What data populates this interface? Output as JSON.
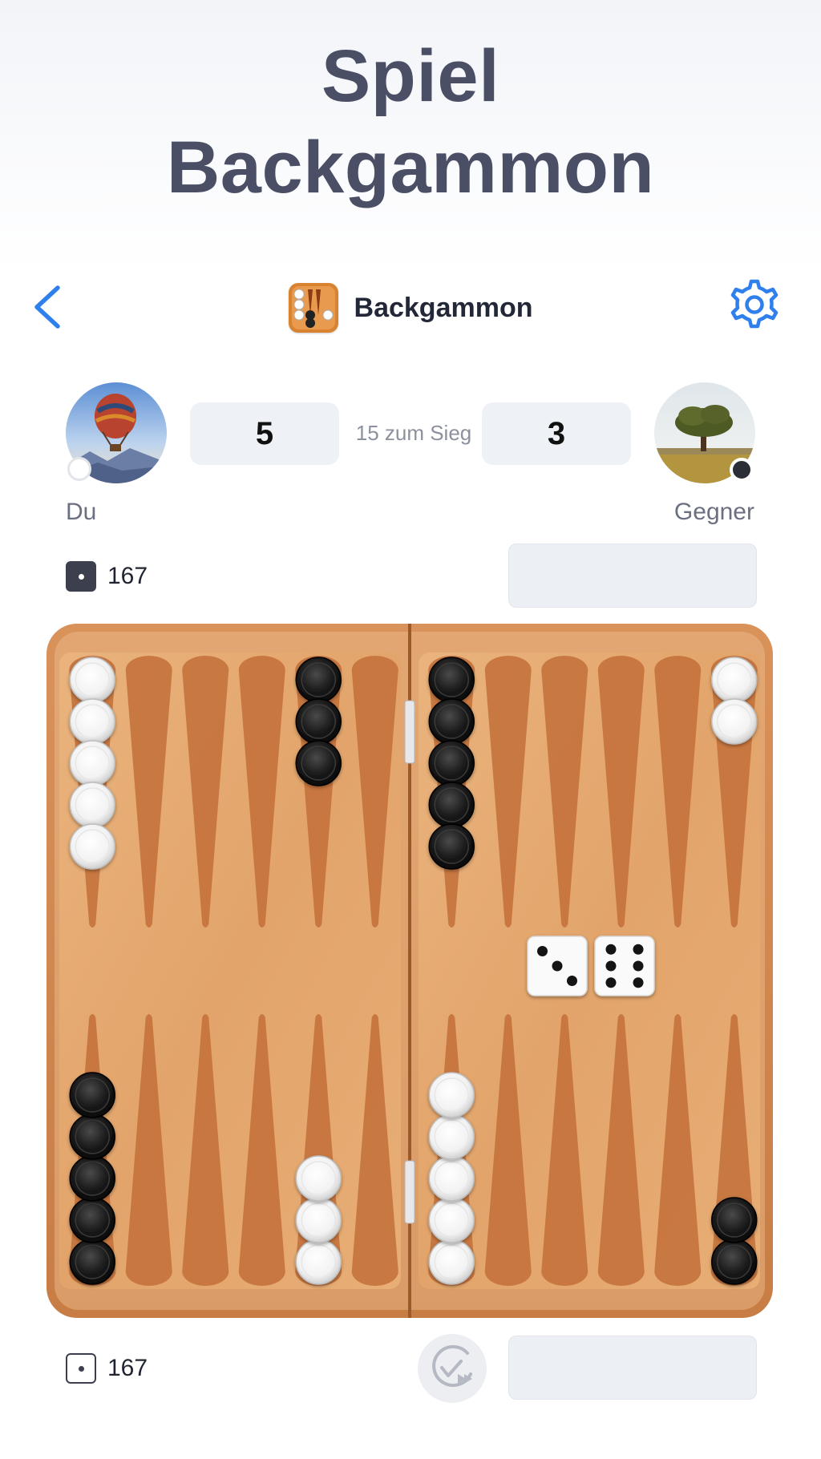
{
  "hero": {
    "line1": "Spiel",
    "line2": "Backgammon"
  },
  "topbar": {
    "title": "Backgammon",
    "back_icon": "chevron-left-icon",
    "settings_icon": "gear-icon",
    "accent_color": "#2f80ed"
  },
  "match": {
    "player": {
      "name": "Du",
      "score": "5",
      "checker_color": "white",
      "pip_count": "167"
    },
    "opponent": {
      "name": "Gegner",
      "score": "3",
      "checker_color": "black",
      "pip_count": "167"
    },
    "target_label": "15 zum Sieg"
  },
  "board": {
    "top_points": [
      {
        "color": "white",
        "count": 5
      },
      {
        "color": "none",
        "count": 0
      },
      {
        "color": "none",
        "count": 0
      },
      {
        "color": "none",
        "count": 0
      },
      {
        "color": "black",
        "count": 3
      },
      {
        "color": "none",
        "count": 0
      },
      {
        "color": "black",
        "count": 5
      },
      {
        "color": "none",
        "count": 0
      },
      {
        "color": "none",
        "count": 0
      },
      {
        "color": "none",
        "count": 0
      },
      {
        "color": "none",
        "count": 0
      },
      {
        "color": "white",
        "count": 2
      }
    ],
    "bottom_points": [
      {
        "color": "black",
        "count": 5
      },
      {
        "color": "none",
        "count": 0
      },
      {
        "color": "none",
        "count": 0
      },
      {
        "color": "none",
        "count": 0
      },
      {
        "color": "white",
        "count": 3
      },
      {
        "color": "none",
        "count": 0
      },
      {
        "color": "white",
        "count": 5
      },
      {
        "color": "none",
        "count": 0
      },
      {
        "color": "none",
        "count": 0
      },
      {
        "color": "none",
        "count": 0
      },
      {
        "color": "none",
        "count": 0
      },
      {
        "color": "black",
        "count": 2
      }
    ],
    "dice": [
      3,
      6
    ],
    "wood_color": "#e4a86d",
    "point_color": "#c5733d"
  },
  "controls": {
    "confirm_icon": "check-forward-icon"
  }
}
